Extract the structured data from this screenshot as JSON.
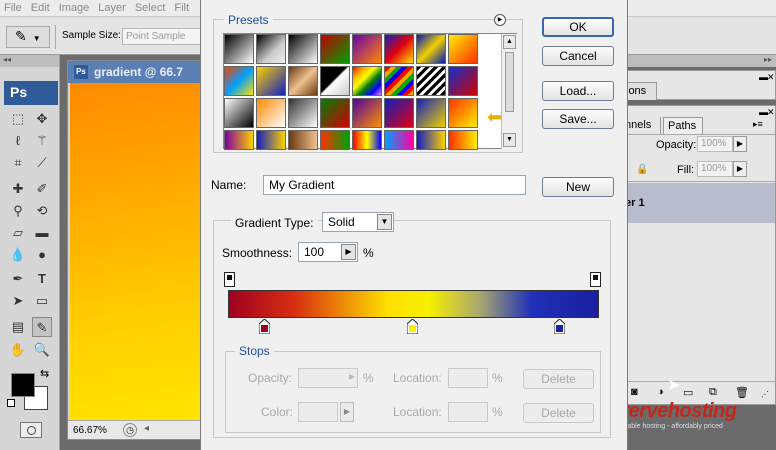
{
  "menubar": {
    "items": [
      "File",
      "Edit",
      "Image",
      "Layer",
      "Select",
      "Filt"
    ]
  },
  "options": {
    "sample_size_label": "Sample Size:",
    "sample_size_value": "Point Sample"
  },
  "toolbox": {
    "logo": "Ps"
  },
  "document": {
    "title": "gradient @ 66.7",
    "zoom": "66.67%"
  },
  "panels": {
    "tab_partial": "ions",
    "tab_channels": "nnels",
    "tab_paths": "Paths",
    "opacity_label": "Opacity:",
    "opacity_value": "100%",
    "fill_label": "Fill:",
    "fill_value": "100%",
    "layer_name": "er 1"
  },
  "dialog": {
    "presets_title": "Presets",
    "ok_label": "OK",
    "cancel_label": "Cancel",
    "load_label": "Load...",
    "save_label": "Save...",
    "name_label": "Name:",
    "name_value": "My Gradient",
    "new_label": "New",
    "gradient_type_label": "Gradient Type:",
    "gradient_type_value": "Solid",
    "smoothness_label": "Smoothness:",
    "smoothness_value": "100",
    "smoothness_unit": "%",
    "stops_title": "Stops",
    "opacity_label": "Opacity:",
    "opacity_unit": "%",
    "location_label": "Location:",
    "location_unit": "%",
    "delete_label": "Delete",
    "color_label": "Color:",
    "location2_label": "Location:",
    "location2_unit": "%",
    "delete2_label": "Delete"
  },
  "watermark": {
    "brand": "vervehosting",
    "tagline": "reliable hosting - affordably priced"
  }
}
